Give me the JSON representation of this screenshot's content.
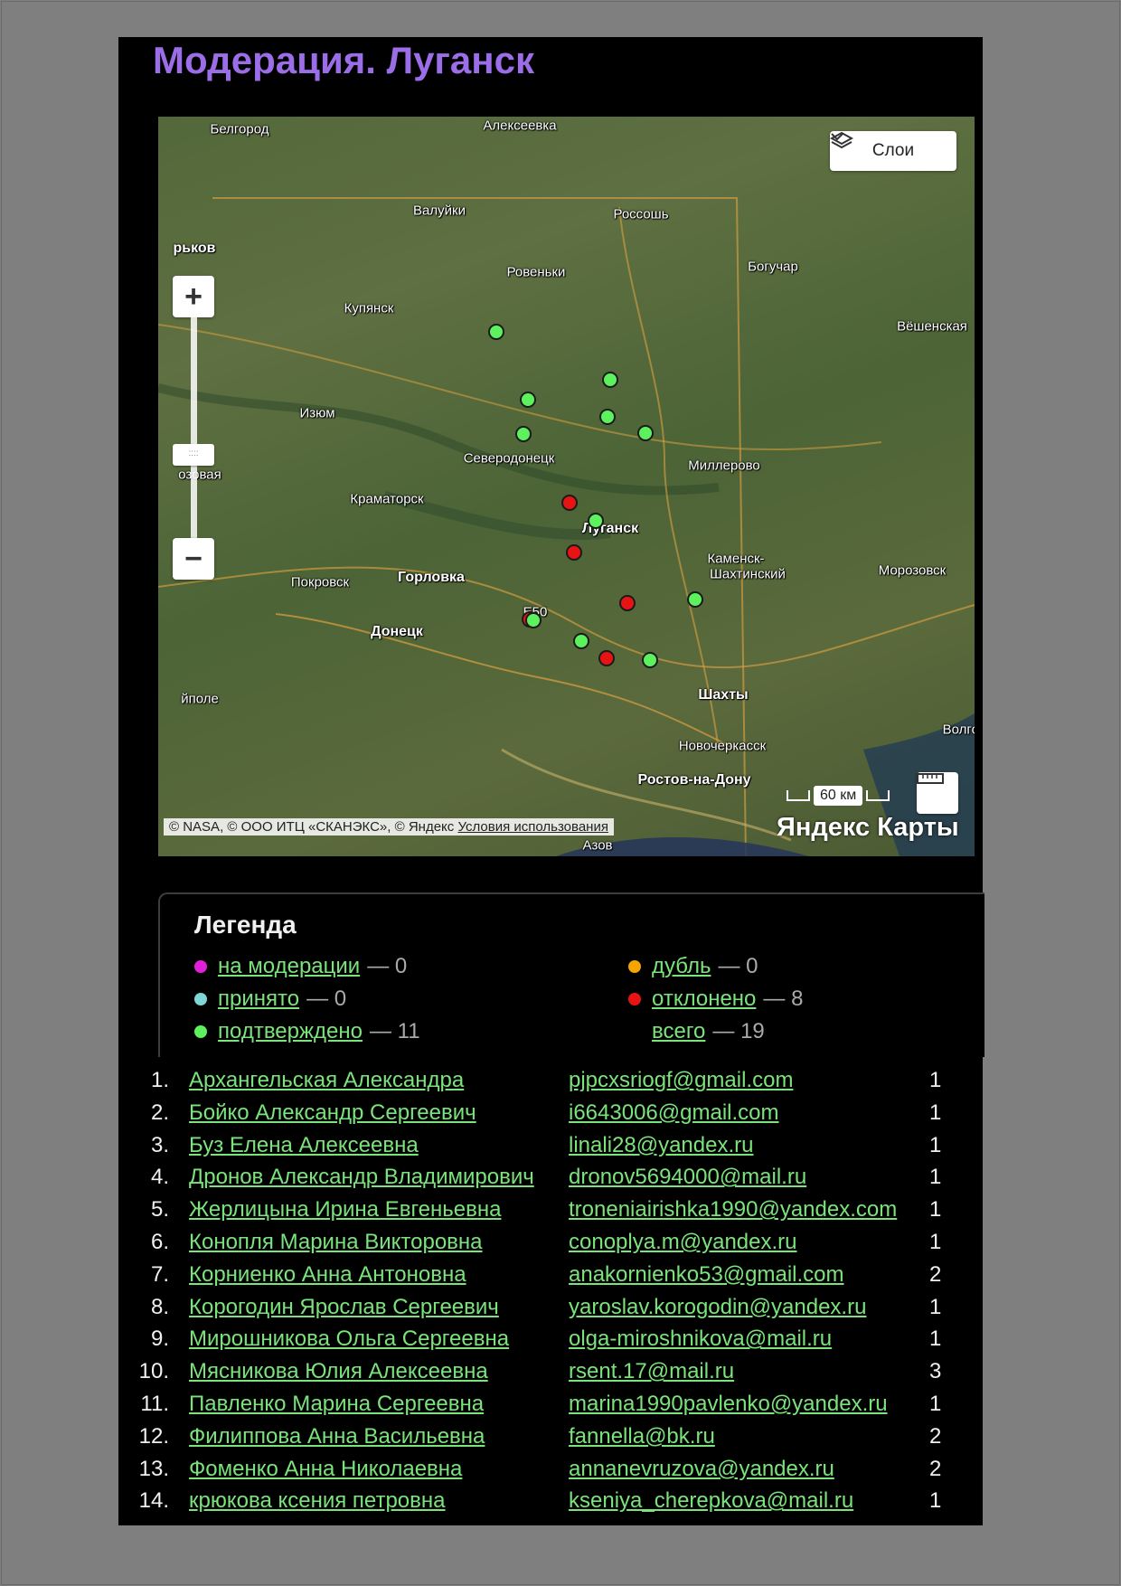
{
  "page": {
    "title": "Модерация. Луганск"
  },
  "map": {
    "layers_label": "Слои",
    "scale_label": "60 км",
    "copyright": "© NASA, © ООО ИТЦ «СКАНЭКС», © Яндекс",
    "terms_link": "Условия использования",
    "logo": "Яндекс Карты",
    "cities": [
      {
        "name": "Белгород",
        "bold": false
      },
      {
        "name": "Алексеевка",
        "bold": false
      },
      {
        "name": "Валуйки",
        "bold": false
      },
      {
        "name": "Россошь",
        "bold": false
      },
      {
        "name": "рьков",
        "bold": true
      },
      {
        "name": "Ровеньки",
        "bold": false
      },
      {
        "name": "Богучар",
        "bold": false
      },
      {
        "name": "Купянск",
        "bold": false
      },
      {
        "name": "Вёшенская",
        "bold": false
      },
      {
        "name": "Изюм",
        "bold": false
      },
      {
        "name": "озовая",
        "bold": false
      },
      {
        "name": "Северодонецк",
        "bold": false
      },
      {
        "name": "Миллерово",
        "bold": false
      },
      {
        "name": "Краматорск",
        "bold": false
      },
      {
        "name": "Луганск",
        "bold": true
      },
      {
        "name": "Каменск-",
        "bold": false
      },
      {
        "name": "Шахтинский",
        "bold": false
      },
      {
        "name": "Морозовск",
        "bold": false
      },
      {
        "name": "Покровск",
        "bold": false
      },
      {
        "name": "Горловка",
        "bold": true
      },
      {
        "name": "Донецк",
        "bold": true
      },
      {
        "name": "E50",
        "bold": false
      },
      {
        "name": "Шахты",
        "bold": true
      },
      {
        "name": "йполе",
        "bold": false
      },
      {
        "name": "Волгод",
        "bold": false
      },
      {
        "name": "Новочеркасск",
        "bold": false
      },
      {
        "name": "Ростов-на-Дону",
        "bold": true
      },
      {
        "name": "Азов",
        "bold": false
      }
    ],
    "markers": [
      {
        "status": "подтверждено",
        "color": "#5ef15e"
      },
      {
        "status": "подтверждено",
        "color": "#5ef15e"
      },
      {
        "status": "подтверждено",
        "color": "#5ef15e"
      },
      {
        "status": "подтверждено",
        "color": "#5ef15e"
      },
      {
        "status": "подтверждено",
        "color": "#5ef15e"
      },
      {
        "status": "подтверждено",
        "color": "#5ef15e"
      },
      {
        "status": "подтверждено",
        "color": "#5ef15e"
      },
      {
        "status": "подтверждено",
        "color": "#5ef15e"
      },
      {
        "status": "подтверждено",
        "color": "#5ef15e"
      },
      {
        "status": "подтверждено",
        "color": "#5ef15e"
      },
      {
        "status": "подтверждено",
        "color": "#5ef15e"
      },
      {
        "status": "отклонено",
        "color": "#e81414"
      },
      {
        "status": "отклонено",
        "color": "#e81414"
      },
      {
        "status": "отклонено",
        "color": "#e81414"
      },
      {
        "status": "отклонено",
        "color": "#e81414"
      },
      {
        "status": "отклонено",
        "color": "#e81414"
      }
    ]
  },
  "legend": {
    "title": "Легенда",
    "items": [
      {
        "label": "на модерации",
        "count": "— 0",
        "color": "#e020d8"
      },
      {
        "label": "принято",
        "count": "— 0",
        "color": "#7ed6d6"
      },
      {
        "label": "подтверждено",
        "count": "— 11",
        "color": "#5ef15e"
      },
      {
        "label": "дубль",
        "count": "— 0",
        "color": "#f5a400"
      },
      {
        "label": "отклонено",
        "count": "— 8",
        "color": "#e81414"
      },
      {
        "label": "всего",
        "count": "— 19",
        "color": ""
      }
    ]
  },
  "users": [
    {
      "num": "1.",
      "name": "Архангельская Александра",
      "email": "pjpcxsriogf@gmail.com",
      "count": "1"
    },
    {
      "num": "2.",
      "name": "Бойко Александр Сергеевич",
      "email": "i6643006@gmail.com",
      "count": "1"
    },
    {
      "num": "3.",
      "name": "Буз Елена Алексеевна",
      "email": "linali28@yandex.ru",
      "count": "1"
    },
    {
      "num": "4.",
      "name": "Дронов Александр Владимирович",
      "email": "dronov5694000@mail.ru",
      "count": "1"
    },
    {
      "num": "5.",
      "name": "Жерлицына Ирина Евгеньевна",
      "email": "troneniairishka1990@yandex.com",
      "count": "1"
    },
    {
      "num": "6.",
      "name": "Конопля Марина Викторовна",
      "email": "conoplya.m@yandex.ru",
      "count": "1"
    },
    {
      "num": "7.",
      "name": "Корниенко Анна Антоновна",
      "email": "anakornienko53@gmail.com",
      "count": "2"
    },
    {
      "num": "8.",
      "name": "Корогодин Ярослав Сергеевич",
      "email": "yaroslav.korogodin@yandex.ru",
      "count": "1"
    },
    {
      "num": "9.",
      "name": "Мирошникова Ольга Сергеевна",
      "email": "olga-miroshnikova@mail.ru",
      "count": "1"
    },
    {
      "num": "10.",
      "name": "Мясникова Юлия Алексеевна",
      "email": "rsent.17@mail.ru",
      "count": "3"
    },
    {
      "num": "11.",
      "name": "Павленко Марина Сергеевна",
      "email": "marina1990pavlenko@yandex.ru",
      "count": "1"
    },
    {
      "num": "12.",
      "name": "Филиппова Анна Васильевна",
      "email": "fannella@bk.ru",
      "count": "2"
    },
    {
      "num": "13.",
      "name": "Фоменко Анна Николаевна",
      "email": "annanevruzova@yandex.ru",
      "count": "2"
    },
    {
      "num": "14.",
      "name": "крюкова ксения петровна",
      "email": "kseniya_cherepkova@mail.ru",
      "count": "1"
    }
  ]
}
